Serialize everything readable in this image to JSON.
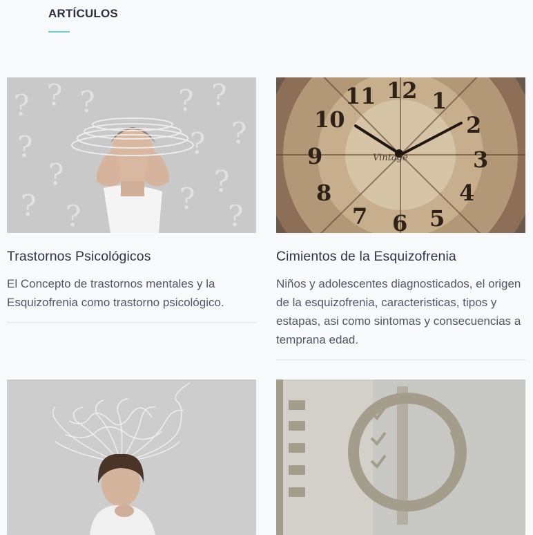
{
  "section": {
    "title": "ARTÍCULOS",
    "accent_color": "#58d6c0"
  },
  "articles": [
    {
      "title": "Trastornos Psicológicos",
      "description": "El Concepto de trastornos mentales y la Esquizofrenia como trastorno psicológico.",
      "image": "man-headache-question-marks"
    },
    {
      "title": "Cimientos de la Esquizofrenia",
      "description": "Niños y adolescentes diagnosticados, el origen de la esquizofrenia, caracteristicas, tipos y estapas, asi como sintomas y consecuencias a temprana edad.",
      "image": "vintage-clock-face"
    },
    {
      "title": "",
      "description": "",
      "image": "woman-thinking-tangled-arrows"
    },
    {
      "title": "",
      "description": "",
      "image": "checklist-magnifier"
    }
  ]
}
